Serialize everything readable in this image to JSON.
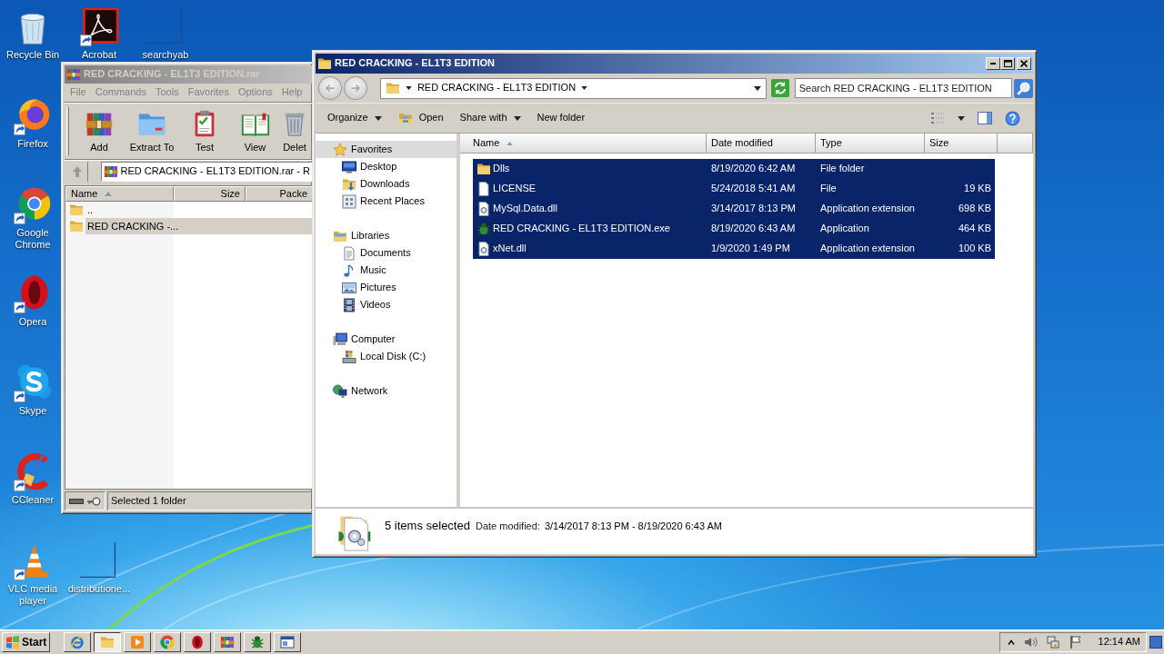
{
  "desktop_icons": [
    {
      "label": "Recycle Bin",
      "kind": "recycle",
      "shortcut": false
    },
    {
      "label": "Acrobat",
      "kind": "acrobat",
      "shortcut": true
    },
    {
      "label": "searchyab",
      "kind": "blank",
      "shortcut": false
    },
    {
      "label": "Firefox",
      "kind": "firefox",
      "shortcut": true
    },
    {
      "label": "Google Chrome",
      "kind": "chrome",
      "shortcut": true
    },
    {
      "label": "Opera",
      "kind": "opera",
      "shortcut": true
    },
    {
      "label": "Skype",
      "kind": "skype",
      "shortcut": true
    },
    {
      "label": "CCleaner",
      "kind": "ccleaner",
      "shortcut": true
    },
    {
      "label": "VLC media player",
      "kind": "vlc",
      "shortcut": true
    },
    {
      "label": "distributione...",
      "kind": "blank",
      "shortcut": false
    }
  ],
  "archiver_window": {
    "title": "RED CRACKING - EL1T3 EDITION.rar",
    "active": false,
    "menu": [
      "File",
      "Commands",
      "Tools",
      "Favorites",
      "Options",
      "Help"
    ],
    "toolbar": [
      {
        "label": "Add",
        "kind": "add"
      },
      {
        "label": "Extract To",
        "kind": "extract"
      },
      {
        "label": "Test",
        "kind": "test"
      },
      {
        "label": "View",
        "kind": "view"
      },
      {
        "label": "Delet",
        "kind": "delete"
      }
    ],
    "path": "RED CRACKING - EL1T3 EDITION.rar - R",
    "columns": [
      {
        "label": "Name",
        "sorted": true
      },
      {
        "label": "Size",
        "sorted": false
      },
      {
        "label": "Packe",
        "sorted": false
      }
    ],
    "rows": [
      {
        "name": "..",
        "selected": false
      },
      {
        "name": "RED CRACKING -...",
        "selected": true
      }
    ],
    "status": "Selected 1 folder"
  },
  "explorer_window": {
    "title": "RED CRACKING - EL1T3 EDITION",
    "active": true,
    "breadcrumb": "RED CRACKING - EL1T3 EDITION",
    "search": {
      "placeholder": "Search RED CRACKING - EL1T3 EDITION"
    },
    "commands": [
      {
        "label": "Organize",
        "kind": "menu"
      },
      {
        "label": "Open",
        "kind": "open"
      },
      {
        "label": "Share with",
        "kind": "menu"
      },
      {
        "label": "New folder",
        "kind": "plain"
      }
    ],
    "navigation": [
      {
        "label": "Favorites",
        "kind": "favorites",
        "selected": true,
        "children": [
          {
            "label": "Desktop",
            "kind": "desktop",
            "selected": false
          },
          {
            "label": "Downloads",
            "kind": "downloads",
            "selected": false
          },
          {
            "label": "Recent Places",
            "kind": "recent",
            "selected": false
          }
        ]
      },
      {
        "label": "Libraries",
        "kind": "libraries",
        "selected": false,
        "children": [
          {
            "label": "Documents",
            "kind": "documents",
            "selected": false
          },
          {
            "label": "Music",
            "kind": "music",
            "selected": false
          },
          {
            "label": "Pictures",
            "kind": "pictures",
            "selected": false
          },
          {
            "label": "Videos",
            "kind": "videos",
            "selected": false
          }
        ]
      },
      {
        "label": "Computer",
        "kind": "computer",
        "selected": false,
        "children": [
          {
            "label": "Local Disk (C:)",
            "kind": "disk",
            "selected": false
          }
        ]
      },
      {
        "label": "Network",
        "kind": "network",
        "selected": false
      }
    ],
    "columns": [
      {
        "label": "Name",
        "sorted": true
      },
      {
        "label": "Date modified",
        "sorted": false
      },
      {
        "label": "Type",
        "sorted": false
      },
      {
        "label": "Size",
        "sorted": false
      }
    ],
    "files": [
      {
        "name": "Dlls",
        "date": "8/19/2020 6:42 AM",
        "type": "File folder",
        "kind": "folder",
        "selected": true
      },
      {
        "name": "LICENSE",
        "date": "5/24/2018 5:41 AM",
        "type": "File",
        "size": "19 KB",
        "kind": "file",
        "selected": true
      },
      {
        "name": "MySql.Data.dll",
        "date": "3/14/2017 8:13 PM",
        "type": "Application extension",
        "size": "698 KB",
        "kind": "dll",
        "selected": true
      },
      {
        "name": "RED CRACKING - EL1T3 EDITION.exe",
        "date": "8/19/2020 6:43 AM",
        "type": "Application",
        "size": "464 KB",
        "kind": "exe",
        "selected": true
      },
      {
        "name": "xNet.dll",
        "date": "1/9/2020 1:49 PM",
        "type": "Application extension",
        "size": "100 KB",
        "kind": "dll",
        "selected": true
      }
    ],
    "details": {
      "summary": "5 items selected",
      "label": "Date modified:",
      "value": "3/14/2017 8:13 PM - 8/19/2020 6:43 AM"
    }
  },
  "taskbar": {
    "start": "Start",
    "apps": [
      {
        "kind": "ie",
        "selected": false
      },
      {
        "kind": "explorer",
        "selected": true
      },
      {
        "kind": "media",
        "selected": false
      },
      {
        "kind": "chrome",
        "selected": false
      },
      {
        "kind": "opera",
        "selected": false
      },
      {
        "kind": "winrar",
        "selected": false
      },
      {
        "kind": "bug",
        "selected": false
      },
      {
        "kind": "window",
        "selected": false
      }
    ],
    "clock": "12:14 AM"
  }
}
